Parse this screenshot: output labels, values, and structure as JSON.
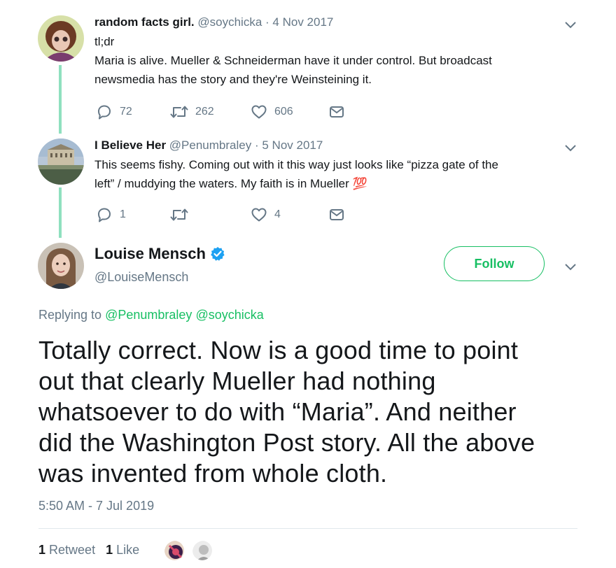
{
  "thread": [
    {
      "name": "random facts girl.",
      "handle": "@soychicka",
      "dot": "·",
      "date": "4 Nov 2017",
      "lines": [
        "tl;dr",
        "Maria is alive. Mueller & Schneiderman have it under control.  But broadcast",
        "newsmedia has the story and they're Weinsteining it."
      ],
      "replies": "72",
      "retweets": "262",
      "likes": "606"
    },
    {
      "name": "I Believe Her",
      "handle": "@Penumbraley",
      "dot": "·",
      "date": "5 Nov 2017",
      "lines": [
        "This seems fishy. Coming out with it this way just looks like “pizza gate of the",
        "left” / muddying the waters. My faith is in Mueller"
      ],
      "emoji": "💯",
      "replies": "1",
      "retweets": "",
      "likes": "4"
    }
  ],
  "main": {
    "name": "Louise Mensch",
    "handle": "@LouiseMensch",
    "follow_label": "Follow",
    "replying_prefix": "Replying to",
    "replying_to": [
      "@Penumbraley",
      "@soychicka"
    ],
    "text_lines": [
      "Totally correct. Now is a good time to point",
      "out that clearly Mueller had nothing",
      "whatsoever to do with “Maria”. And neither",
      "did the Washington Post story. All the above",
      "was invented from whole cloth."
    ],
    "timestamp": "5:50 AM - 7 Jul 2019",
    "retweet_count": "1",
    "retweet_label": "Retweet",
    "like_count": "1",
    "like_label": "Like"
  },
  "colors": {
    "accent_green": "#17bf63",
    "thread_line": "#8fe0bf",
    "verified_blue": "#1da1f2",
    "secondary_text": "#657786"
  },
  "icons": [
    "reply-icon",
    "retweet-icon",
    "like-icon",
    "dm-icon",
    "chevron-down-icon",
    "verified-badge-icon"
  ]
}
